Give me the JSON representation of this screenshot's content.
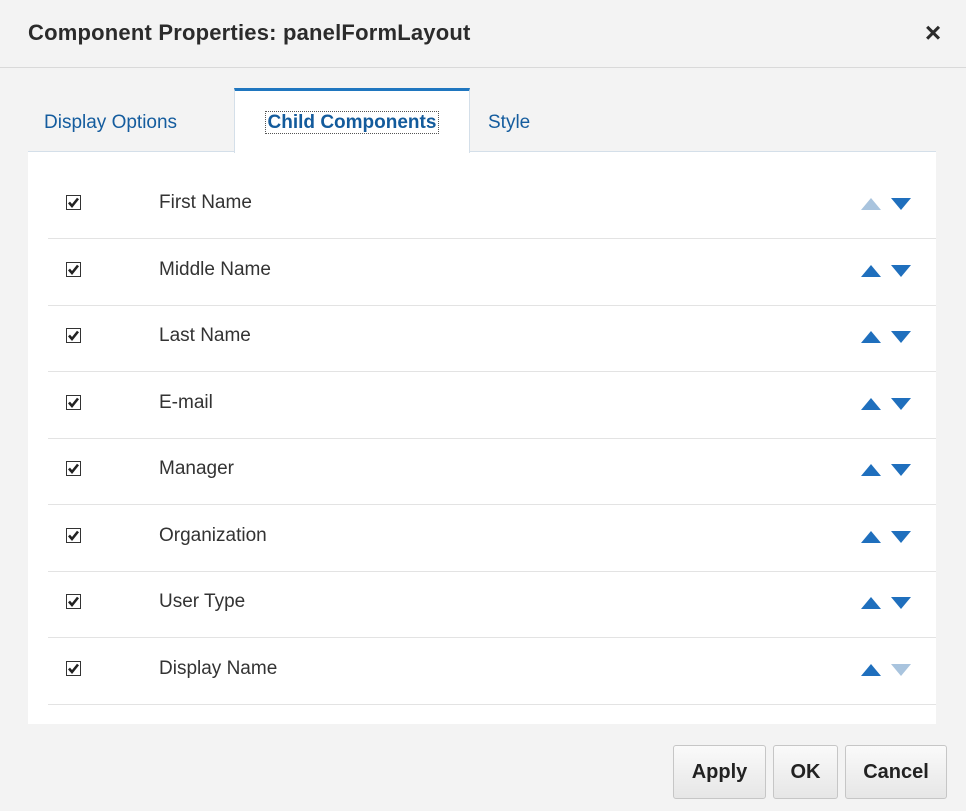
{
  "dialog": {
    "title": "Component Properties: panelFormLayout",
    "close_symbol": "×"
  },
  "tabs": [
    {
      "label": "Display Options",
      "selected": false
    },
    {
      "label": "Child Components",
      "selected": true
    },
    {
      "label": "Style",
      "selected": false
    }
  ],
  "components": [
    {
      "label": "First Name",
      "checked": true,
      "up_enabled": false,
      "down_enabled": true
    },
    {
      "label": "Middle Name",
      "checked": true,
      "up_enabled": true,
      "down_enabled": true
    },
    {
      "label": "Last Name",
      "checked": true,
      "up_enabled": true,
      "down_enabled": true
    },
    {
      "label": "E-mail",
      "checked": true,
      "up_enabled": true,
      "down_enabled": true
    },
    {
      "label": "Manager",
      "checked": true,
      "up_enabled": true,
      "down_enabled": true
    },
    {
      "label": "Organization",
      "checked": true,
      "up_enabled": true,
      "down_enabled": true
    },
    {
      "label": "User Type",
      "checked": true,
      "up_enabled": true,
      "down_enabled": true
    },
    {
      "label": "Display Name",
      "checked": true,
      "up_enabled": true,
      "down_enabled": false
    }
  ],
  "buttons": {
    "apply": "Apply",
    "ok": "OK",
    "cancel": "Cancel"
  },
  "colors": {
    "arrow_enabled": "#1f6fbd",
    "arrow_disabled": "#a9c4de",
    "tab_accent": "#1f76bf",
    "link": "#145c9e"
  },
  "icons": {
    "close": "close-icon",
    "checkbox": "checkmark-icon",
    "move_up": "move-up-arrow-icon",
    "move_down": "move-down-arrow-icon"
  }
}
